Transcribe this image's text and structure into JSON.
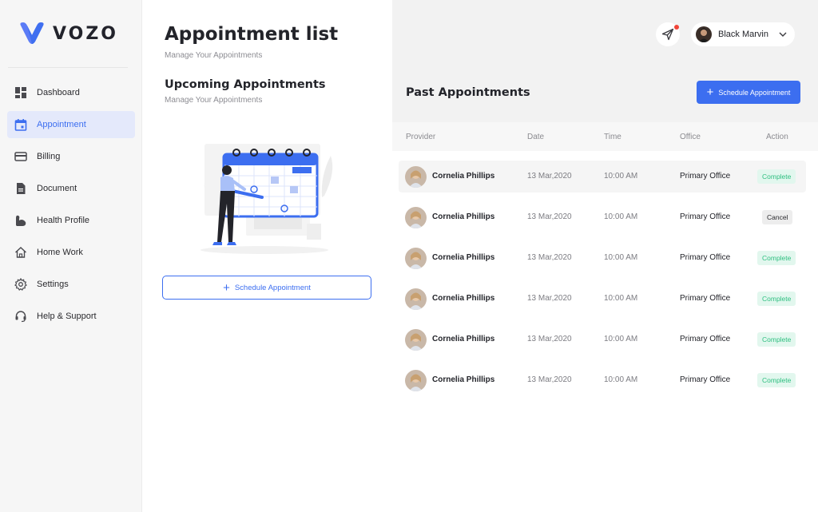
{
  "brand": {
    "name": "VOZO",
    "accent": "#3c6ef0"
  },
  "sidebar": {
    "items": [
      {
        "label": "Dashboard",
        "icon": "dashboard-icon",
        "active": false
      },
      {
        "label": "Appointment",
        "icon": "calendar-icon",
        "active": true
      },
      {
        "label": "Billing",
        "icon": "credit-card-icon",
        "active": false
      },
      {
        "label": "Document",
        "icon": "document-icon",
        "active": false
      },
      {
        "label": "Health Profile",
        "icon": "muscle-icon",
        "active": false
      },
      {
        "label": "Home Work",
        "icon": "home-icon",
        "active": false
      },
      {
        "label": "Settings",
        "icon": "gear-icon",
        "active": false
      },
      {
        "label": "Help & Support",
        "icon": "headset-icon",
        "active": false
      }
    ]
  },
  "middle": {
    "title": "Appointment list",
    "subtitle": "Manage Your Appointments",
    "upcoming_title": "Upcoming Appointments",
    "upcoming_subtitle": "Manage Your Appointments",
    "schedule_label": "Schedule Appointment"
  },
  "header": {
    "user_name": "Black Marvin",
    "notification_icon": "send-icon"
  },
  "past": {
    "title": "Past Appointments",
    "schedule_label": "Schedule Appointment",
    "columns": [
      "Provider",
      "Date",
      "Time",
      "Office",
      "Action"
    ],
    "rows": [
      {
        "provider": "Cornelia Phillips",
        "date": "13 Mar,2020",
        "time": "10:00 AM",
        "office": "Primary Office",
        "status": "Complete"
      },
      {
        "provider": "Cornelia Phillips",
        "date": "13 Mar,2020",
        "time": "10:00 AM",
        "office": "Primary Office",
        "status": "Cancel"
      },
      {
        "provider": "Cornelia Phillips",
        "date": "13 Mar,2020",
        "time": "10:00 AM",
        "office": "Primary Office",
        "status": "Complete"
      },
      {
        "provider": "Cornelia Phillips",
        "date": "13 Mar,2020",
        "time": "10:00 AM",
        "office": "Primary Office",
        "status": "Complete"
      },
      {
        "provider": "Cornelia Phillips",
        "date": "13 Mar,2020",
        "time": "10:00 AM",
        "office": "Primary Office",
        "status": "Complete"
      },
      {
        "provider": "Cornelia Phillips",
        "date": "13 Mar,2020",
        "time": "10:00 AM",
        "office": "Primary Office",
        "status": "Complete"
      }
    ]
  }
}
